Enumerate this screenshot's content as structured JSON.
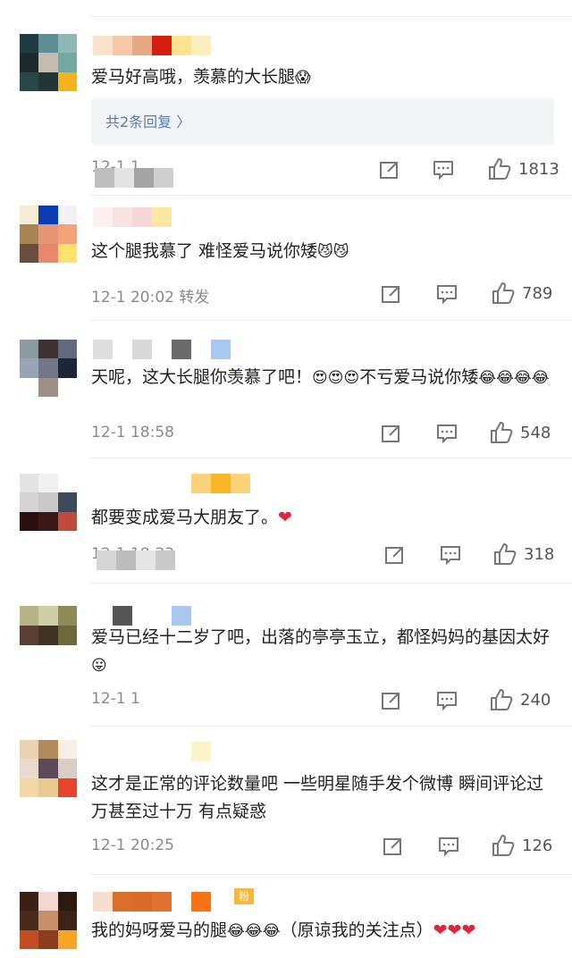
{
  "comments": [
    {
      "text": "爱马好高哦，羡慕的大长腿",
      "emoji": "😱",
      "reply_label": "共2条回复 〉",
      "time": "12-1 1",
      "likes": "1813"
    },
    {
      "text": "这个腿我慕了 难怪爱马说你矮",
      "emoji": "😼😼",
      "time": "12-1 20:02 转发",
      "likes": "789"
    },
    {
      "text": "天呢，这大长腿你羡慕了吧！",
      "emoji1": "😍😍😍",
      "text2": "不亏爱马说你矮",
      "emoji2": "😂😂😂😂",
      "time": "12-1 18:58",
      "likes": "548"
    },
    {
      "text": "都要变成爱马大朋友了。",
      "emoji": "❤",
      "time": "12-1 18:33",
      "likes": "318"
    },
    {
      "text": "爱马已经十二岁了吧，出落的亭亭玉立，都怪妈妈的基因太好",
      "emoji": "😛",
      "time": "12-1 1",
      "likes": "240"
    },
    {
      "text": "这才是正常的评论数量吧 一些明星随手发个微博 瞬间评论过万甚至过十万 有点疑惑",
      "time": "12-1 20:25",
      "likes": "126"
    },
    {
      "text": "我的妈呀爱马的腿",
      "emoji1": "😂😂😂",
      "text2": "（原谅我的关注点）",
      "emoji2": "❤❤❤",
      "badge": "粉"
    }
  ],
  "colors": {
    "link": "#5b7ea8",
    "meta": "#8a8a8a",
    "heart": "#e0253b"
  },
  "icons": [
    "share-icon",
    "comment-icon",
    "like-icon"
  ]
}
